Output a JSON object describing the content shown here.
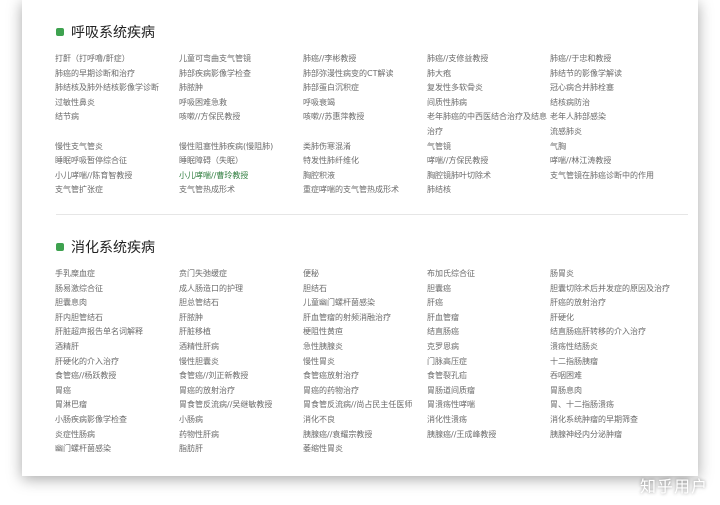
{
  "sections": [
    {
      "title": "呼吸系统疾病",
      "columns": [
        [
          "打鼾（打呼噜/鼾症）",
          "肺癌的早期诊断和治疗",
          "肺结核及肺外结核影像学诊断",
          "过敏性鼻炎",
          "结节病",
          "",
          "慢性支气管炎",
          "睡眠呼吸暂停综合征",
          "小儿哮喘//陈育智教授",
          "支气管扩张症"
        ],
        [
          "儿童可弯曲支气管镜",
          "肺部疾病影像学检查",
          "肺脓肿",
          "呼吸困难急救",
          "咳嗽//方保民教授",
          "",
          "慢性阻塞性肺疾病(慢阻肺)",
          "睡眠障碍（失眠）",
          "小儿哮喘//曹玲教授",
          "支气管热成形术"
        ],
        [
          "肺癌//李彬教授",
          "肺部弥漫性病变的CT解读",
          "肺部蛋白沉积症",
          "呼吸衰竭",
          "咳嗽//苏惠萍教授",
          "",
          "类肺伤寒混淆",
          "特发性肺纤维化",
          "胸腔积液",
          "重症哮喘的支气管热成形术"
        ],
        [
          "肺癌//支修益教授",
          "肺大疱",
          "复发性多软骨炎",
          "间质性肺病",
          "老年肺癌的中西医结合治疗及结息",
          "治疗",
          "气管镜",
          "哮喘//方保民教授",
          "胸腔镜肺叶切除术",
          "肺结核"
        ],
        [
          "肺癌//于忠和教授",
          "肺结节的影像学解读",
          "冠心病合并肺栓塞",
          "结核病防治",
          "老年人肺部感染",
          "流感肺炎",
          "气胸",
          "哮喘//林江涛教授",
          "支气管镜在肺癌诊断中的作用",
          ""
        ]
      ]
    },
    {
      "title": "消化系统疾病",
      "columns": [
        [
          "手乳糜血症",
          "肠易激综合征",
          "胆囊息肉",
          "肝内胆管结石",
          "肝脏超声报告单名词解释",
          "酒精肝",
          "肝硬化的介入治疗",
          "食管癌//杨跃教授",
          "胃癌",
          "胃淋巴瘤",
          "小肠疾病影像学检查",
          "炎症性肠病",
          "幽门螺杆菌感染"
        ],
        [
          "贲门失弛缓症",
          "成人肠造口的护理",
          "胆总管结石",
          "肝脓肿",
          "肝脏移植",
          "酒精性肝病",
          "慢性胆囊炎",
          "食管癌//刘正新教授",
          "胃癌的放射治疗",
          "胃食管反流病//吴继敏教授",
          "小肠病",
          "药物性肝病",
          "脂肪肝"
        ],
        [
          "便秘",
          "胆结石",
          "儿童幽门螺杆菌感染",
          "肝血管瘤的射频消融治疗",
          "梗阻性黄疸",
          "急性胰腺炎",
          "慢性胃炎",
          "食管癌放射治疗",
          "胃癌的药物治疗",
          "胃食管反流病//尚占民主任医师",
          "消化不良",
          "胰腺癌//袁耀宗教授",
          "萎缩性胃炎"
        ],
        [
          "布加氏综合征",
          "胆囊癌",
          "肝癌",
          "肝血管瘤",
          "结直肠癌",
          "克罗恩病",
          "门脉高压症",
          "食管裂孔疝",
          "胃肠道间质瘤",
          "胃溃疡性哮喘",
          "消化性溃疡",
          "胰腺癌//王成峰教授"
        ],
        [
          "肠胃炎",
          "胆囊切除术后并发症的原因及治疗",
          "肝癌的放射治疗",
          "肝硬化",
          "结直肠癌肝转移的介入治疗",
          "溃疡性结肠炎",
          "十二指肠胰瘤",
          "吞咽困难",
          "胃肠息肉",
          "胃、十二指肠溃疡",
          "消化系统肿瘤的早期筛查",
          "胰腺神经内分泌肿瘤"
        ]
      ]
    }
  ],
  "highlight_color": "#2f7d3e",
  "accent_color": "#3ea24f",
  "watermark": "知乎用户"
}
